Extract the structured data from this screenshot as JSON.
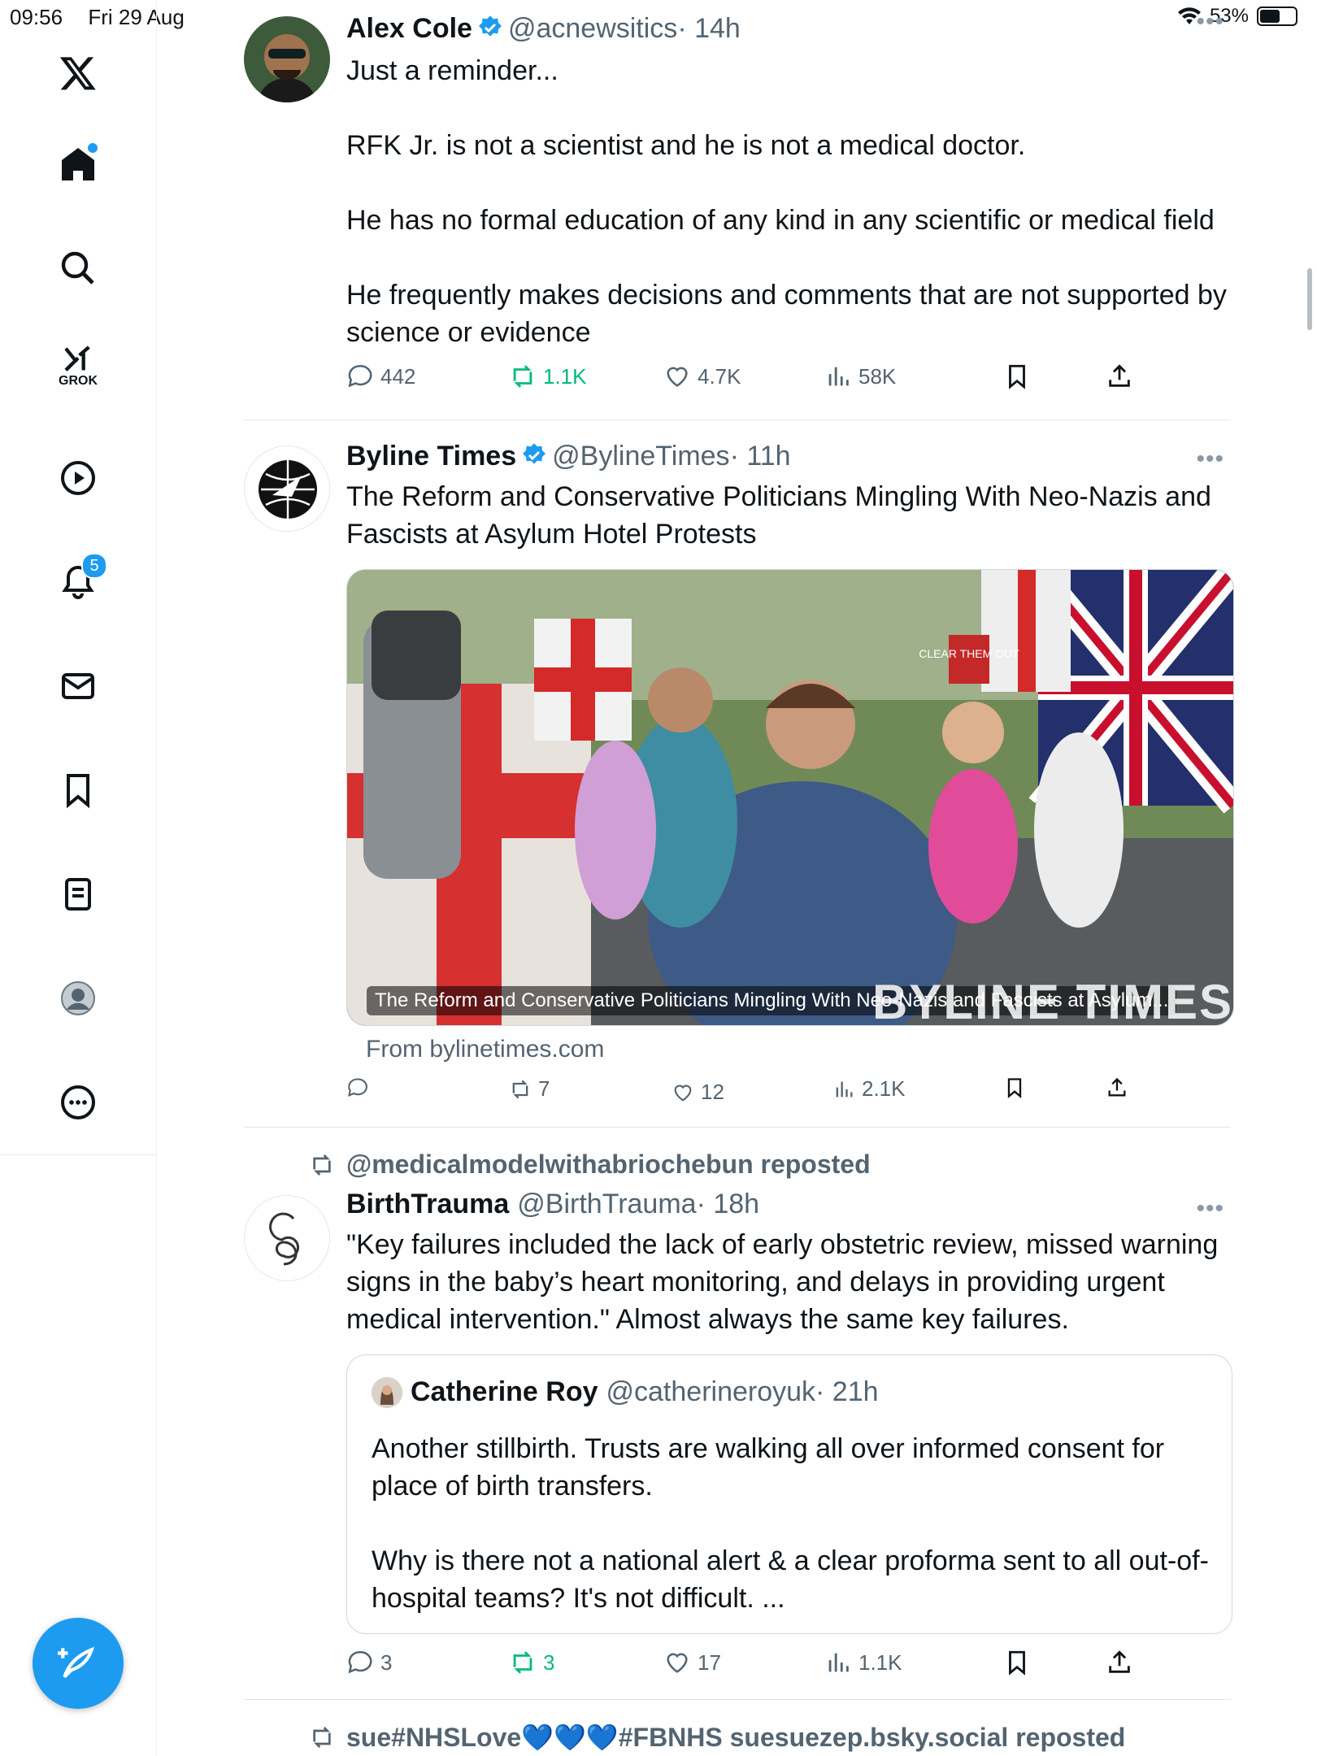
{
  "status_bar": {
    "time": "09:56",
    "date": "Fri 29 Aug",
    "battery": "53%"
  },
  "sidebar": {
    "grok_label": "GROK",
    "notifications_count": "5"
  },
  "posts": [
    {
      "name": "Alex Cole",
      "handle": "@acnewsitics",
      "time": "· 14h",
      "text": "Just a reminder...\n\nRFK Jr. is not a scientist and he is not a medical doctor.\n\nHe has no formal education of any kind in any scientific or medical field\n\nHe frequently makes decisions and comments that are not supported by science or evidence",
      "replies": "442",
      "reposts": "1.1K",
      "likes": "4.7K",
      "views": "58K"
    },
    {
      "name": "Byline Times",
      "handle": "@BylineTimes",
      "time": "· 11h",
      "text": "The Reform and Conservative Politicians Mingling With Neo-Nazis and Fascists at Asylum Hotel Protests",
      "media_caption": "The Reform and Conservative Politicians Mingling With Neo-Nazis and Fascists at Asylum...",
      "media_watermark": "BYLINE TIMES",
      "sign_text": "CLEAR THEM OUT",
      "link_source": "From bylinetimes.com",
      "replies": "",
      "reposts": "7",
      "likes": "12",
      "views": "2.1K"
    },
    {
      "repost_by": "@medicalmodelwithabriochebun reposted",
      "name": "BirthTrauma",
      "handle": "@BirthTrauma",
      "time": "· 18h",
      "text": "\"Key failures included the lack of early obstetric review, missed warning signs in the baby’s heart monitoring, and delays in providing urgent medical intervention.\" Almost always the same key failures.",
      "quote": {
        "name": "Catherine Roy",
        "handle": "@catherineroyuk",
        "time": "· 21h",
        "text": "Another stillbirth. Trusts are walking all over informed consent for place of birth transfers.\n\nWhy is there not a national alert & a clear proforma sent to all out-of-hospital teams? It's not difficult. ..."
      },
      "replies": "3",
      "reposts": "3",
      "likes": "17",
      "views": "1.1K"
    }
  ],
  "next_repost_line": "sue#NHSLove💙💙💙#FBNHS suesuezep.bsky.social reposted",
  "colors": {
    "accent": "#1d9bf0",
    "repost_green": "#00ba7c",
    "muted": "#536471"
  }
}
